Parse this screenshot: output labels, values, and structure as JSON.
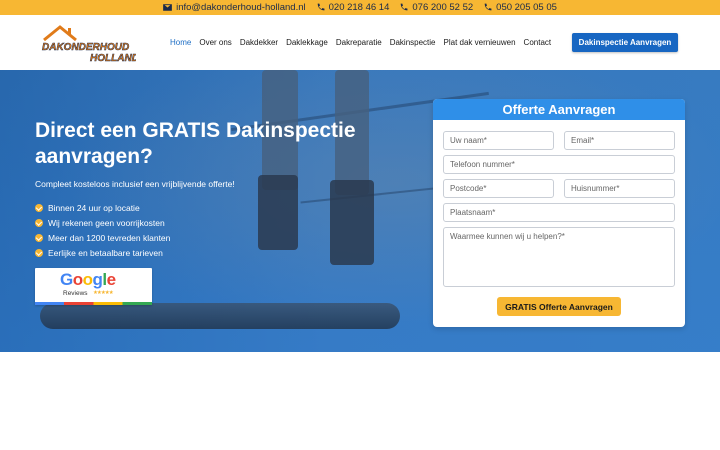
{
  "topbar": {
    "email": "info@dakonderhoud-holland.nl",
    "phone1": "020 218 46 14",
    "phone2": "076 200 52 52",
    "phone3": "050 205 05 05"
  },
  "logo": {
    "line1": "DAKONDERHOUD",
    "line2": "HOLLAND"
  },
  "nav": {
    "items": [
      "Home",
      "Over ons",
      "Dakdekker",
      "Daklekkage",
      "Dakreparatie",
      "Dakinspectie",
      "Plat dak vernieuwen",
      "Contact"
    ],
    "cta": "Dakinspectie Aanvragen"
  },
  "hero": {
    "title": "Direct een GRATIS Dakinspectie aanvragen?",
    "subtitle": "Compleet kosteloos inclusief een vrijblijvende offerte!",
    "checks": [
      "Binnen 24 uur op locatie",
      "Wij rekenen geen voorrijkosten",
      "Meer dan 1200 tevreden klanten",
      "Eerlijke en betaalbare tarieven"
    ],
    "google_word": "Google",
    "google_reviews": "Reviews",
    "google_stars": "★★★★★"
  },
  "form": {
    "title": "Offerte Aanvragen",
    "name_ph": "Uw naam*",
    "email_ph": "Email*",
    "phone_ph": "Telefoon nummer*",
    "postcode_ph": "Postcode*",
    "house_ph": "Huisnummer*",
    "city_ph": "Plaatsnaam*",
    "message_ph": "Waarmee kunnen wij u helpen?*",
    "submit": "GRATIS Offerte Aanvragen"
  },
  "colors": {
    "accent_yellow": "#f7b733",
    "brand_blue": "#1766c2",
    "form_head_blue": "#2f8fe8",
    "logo_orange": "#e07b1a",
    "logo_navy": "#1b2a4a"
  },
  "icons": [
    "email-icon",
    "phone-icon",
    "check-icon",
    "roof-logo-icon"
  ]
}
